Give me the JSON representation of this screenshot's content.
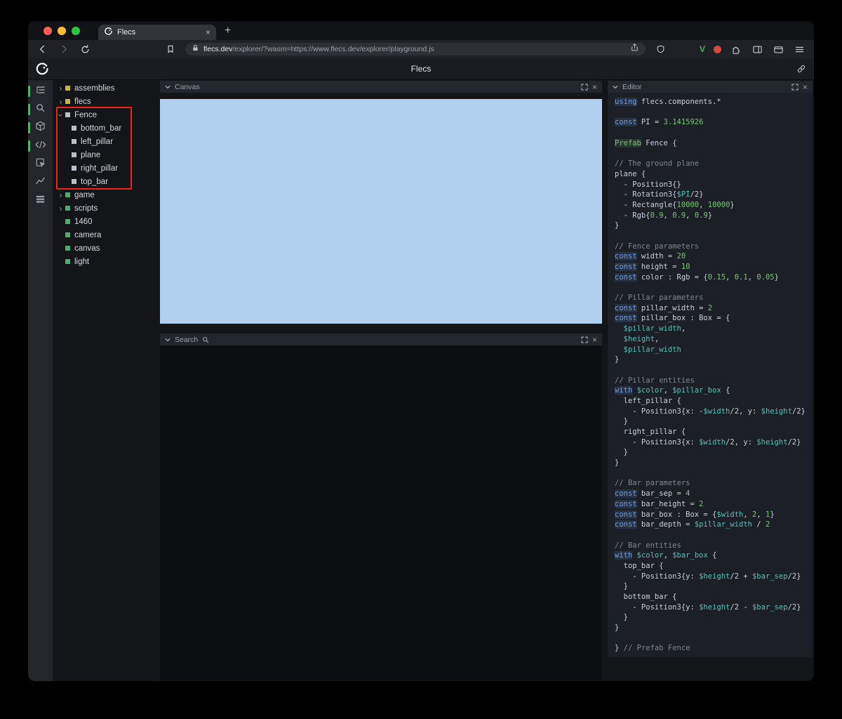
{
  "ui": {
    "close_glyph": "×",
    "plus_glyph": "+",
    "arrow_glyph": "›"
  },
  "browser": {
    "tab_title": "Flecs",
    "url_domain": "flecs.dev",
    "url_path": "/explorer/?wasm=https://www.flecs.dev/explorer/playground.js",
    "v_badge": "V"
  },
  "header": {
    "title": "Flecs"
  },
  "panels": {
    "canvas": {
      "title": "Canvas"
    },
    "search": {
      "title": "Search"
    },
    "editor": {
      "title": "Editor"
    }
  },
  "colors": {
    "accent_green": "#54b06a",
    "annotation_red": "#f0241a",
    "canvas_blue": "#b1d0f0",
    "tree_yellow": "#c9b34a",
    "tree_gray": "#b9bfc8",
    "tree_green": "#4fae6d",
    "traffic_red": "#ff5f57",
    "traffic_yellow": "#febc2e",
    "traffic_green": "#28c840"
  },
  "icons": [
    "flecs-logo-icon",
    "back-icon",
    "forward-icon",
    "reload-icon",
    "bookmark-icon",
    "lock-icon",
    "share-icon",
    "shield-icon",
    "v-extension-icon",
    "record-icon",
    "puzzle-icon",
    "sidebar-toggle-icon",
    "wallet-icon",
    "menu-icon",
    "link-icon",
    "chevron-down-icon",
    "expand-icon",
    "close-icon",
    "magnifier-icon",
    "outliner-icon",
    "search-icon",
    "cube-icon",
    "code-icon",
    "inspect-icon",
    "chart-icon",
    "stats-icon"
  ],
  "tree": {
    "items": [
      {
        "label": "assemblies",
        "square": "yellow",
        "state": "closed",
        "depth": 0
      },
      {
        "label": "flecs",
        "square": "yellow",
        "state": "closed",
        "depth": 0
      },
      {
        "label": "Fence",
        "square": "gray",
        "state": "open",
        "depth": 0
      },
      {
        "label": "bottom_bar",
        "square": "gray",
        "state": "leaf",
        "depth": 1
      },
      {
        "label": "left_pillar",
        "square": "gray",
        "state": "leaf",
        "depth": 1
      },
      {
        "label": "plane",
        "square": "gray",
        "state": "leaf",
        "depth": 1
      },
      {
        "label": "right_pillar",
        "square": "gray",
        "state": "leaf",
        "depth": 1
      },
      {
        "label": "top_bar",
        "square": "gray",
        "state": "leaf",
        "depth": 1
      },
      {
        "label": "game",
        "square": "green",
        "state": "closed",
        "depth": 0
      },
      {
        "label": "scripts",
        "square": "green",
        "state": "closed",
        "depth": 0
      },
      {
        "label": "1460",
        "square": "green",
        "state": "leaf",
        "depth": 0
      },
      {
        "label": "camera",
        "square": "green",
        "state": "leaf",
        "depth": 0
      },
      {
        "label": "canvas",
        "square": "green",
        "state": "leaf",
        "depth": 0
      },
      {
        "label": "light",
        "square": "green",
        "state": "leaf",
        "depth": 0
      }
    ]
  },
  "code": {
    "lines": [
      [
        [
          "kw",
          "using"
        ],
        [
          "pl",
          " flecs.components.*"
        ]
      ],
      [],
      [
        [
          "kw",
          "const"
        ],
        [
          "pl",
          " PI = "
        ],
        [
          "num",
          "3.1415926"
        ]
      ],
      [],
      [
        [
          "pf",
          "Prefab"
        ],
        [
          "pl",
          " Fence {"
        ]
      ],
      [],
      [
        [
          "cm",
          "// The ground plane"
        ]
      ],
      [
        [
          "pl",
          "plane {"
        ]
      ],
      [
        [
          "pl",
          "  - Position3{}"
        ]
      ],
      [
        [
          "pl",
          "  - Rotation3{"
        ],
        [
          "var",
          "$PI"
        ],
        [
          "pl",
          "/2}"
        ]
      ],
      [
        [
          "pl",
          "  - Rectangle{"
        ],
        [
          "num",
          "10000"
        ],
        [
          "pl",
          ", "
        ],
        [
          "num",
          "10000"
        ],
        [
          "pl",
          "}"
        ]
      ],
      [
        [
          "pl",
          "  - Rgb{"
        ],
        [
          "num",
          "0.9"
        ],
        [
          "pl",
          ", "
        ],
        [
          "num",
          "0.9"
        ],
        [
          "pl",
          ", "
        ],
        [
          "num",
          "0.9"
        ],
        [
          "pl",
          "}"
        ]
      ],
      [
        [
          "pl",
          "}"
        ]
      ],
      [],
      [
        [
          "cm",
          "// Fence parameters"
        ]
      ],
      [
        [
          "kw",
          "const"
        ],
        [
          "pl",
          " width = "
        ],
        [
          "num",
          "20"
        ]
      ],
      [
        [
          "kw",
          "const"
        ],
        [
          "pl",
          " height = "
        ],
        [
          "num",
          "10"
        ]
      ],
      [
        [
          "kw",
          "const"
        ],
        [
          "pl",
          " color : Rgb = {"
        ],
        [
          "num",
          "0.15"
        ],
        [
          "pl",
          ", "
        ],
        [
          "num",
          "0.1"
        ],
        [
          "pl",
          ", "
        ],
        [
          "num",
          "0.05"
        ],
        [
          "pl",
          "}"
        ]
      ],
      [],
      [
        [
          "cm",
          "// Pillar parameters"
        ]
      ],
      [
        [
          "kw",
          "const"
        ],
        [
          "pl",
          " pillar_width = "
        ],
        [
          "num",
          "2"
        ]
      ],
      [
        [
          "kw",
          "const"
        ],
        [
          "pl",
          " pillar_box : Box = {"
        ]
      ],
      [
        [
          "pl",
          "  "
        ],
        [
          "var",
          "$pillar_width"
        ],
        [
          "pl",
          ","
        ]
      ],
      [
        [
          "pl",
          "  "
        ],
        [
          "var",
          "$height"
        ],
        [
          "pl",
          ","
        ]
      ],
      [
        [
          "pl",
          "  "
        ],
        [
          "var",
          "$pillar_width"
        ]
      ],
      [
        [
          "pl",
          "}"
        ]
      ],
      [],
      [
        [
          "cm",
          "// Pillar entities"
        ]
      ],
      [
        [
          "kw",
          "with"
        ],
        [
          "pl",
          " "
        ],
        [
          "var",
          "$color"
        ],
        [
          "pl",
          ", "
        ],
        [
          "var",
          "$pillar_box"
        ],
        [
          "pl",
          " {"
        ]
      ],
      [
        [
          "pl",
          "  left_pillar {"
        ]
      ],
      [
        [
          "pl",
          "    - Position3{x: -"
        ],
        [
          "var",
          "$width"
        ],
        [
          "pl",
          "/2, y: "
        ],
        [
          "var",
          "$height"
        ],
        [
          "pl",
          "/2}"
        ]
      ],
      [
        [
          "pl",
          "  }"
        ]
      ],
      [
        [
          "pl",
          "  right_pillar {"
        ]
      ],
      [
        [
          "pl",
          "    - Position3{x: "
        ],
        [
          "var",
          "$width"
        ],
        [
          "pl",
          "/2, y: "
        ],
        [
          "var",
          "$height"
        ],
        [
          "pl",
          "/2}"
        ]
      ],
      [
        [
          "pl",
          "  }"
        ]
      ],
      [
        [
          "pl",
          "}"
        ]
      ],
      [],
      [
        [
          "cm",
          "// Bar parameters"
        ]
      ],
      [
        [
          "kw",
          "const"
        ],
        [
          "pl",
          " bar_sep = "
        ],
        [
          "num",
          "4"
        ]
      ],
      [
        [
          "kw",
          "const"
        ],
        [
          "pl",
          " bar_height = "
        ],
        [
          "num",
          "2"
        ]
      ],
      [
        [
          "kw",
          "const"
        ],
        [
          "pl",
          " bar_box : Box = {"
        ],
        [
          "var",
          "$width"
        ],
        [
          "pl",
          ", "
        ],
        [
          "num",
          "2"
        ],
        [
          "pl",
          ", "
        ],
        [
          "num",
          "1"
        ],
        [
          "pl",
          "}"
        ]
      ],
      [
        [
          "kw",
          "const"
        ],
        [
          "pl",
          " bar_depth = "
        ],
        [
          "var",
          "$pillar_width"
        ],
        [
          "pl",
          " / "
        ],
        [
          "num",
          "2"
        ]
      ],
      [],
      [
        [
          "cm",
          "// Bar entities"
        ]
      ],
      [
        [
          "kw",
          "with"
        ],
        [
          "pl",
          " "
        ],
        [
          "var",
          "$color"
        ],
        [
          "pl",
          ", "
        ],
        [
          "var",
          "$bar_box"
        ],
        [
          "pl",
          " {"
        ]
      ],
      [
        [
          "pl",
          "  top_bar {"
        ]
      ],
      [
        [
          "pl",
          "    - Position3{y: "
        ],
        [
          "var",
          "$height"
        ],
        [
          "pl",
          "/2 + "
        ],
        [
          "var",
          "$bar_sep"
        ],
        [
          "pl",
          "/2}"
        ]
      ],
      [
        [
          "pl",
          "  }"
        ]
      ],
      [
        [
          "pl",
          "  bottom_bar {"
        ]
      ],
      [
        [
          "pl",
          "    - Position3{y: "
        ],
        [
          "var",
          "$height"
        ],
        [
          "pl",
          "/2 - "
        ],
        [
          "var",
          "$bar_sep"
        ],
        [
          "pl",
          "/2}"
        ]
      ],
      [
        [
          "pl",
          "  }"
        ]
      ],
      [
        [
          "pl",
          "}"
        ]
      ],
      [],
      [
        [
          "pl",
          "} "
        ],
        [
          "cm",
          "// Prefab Fence"
        ]
      ]
    ]
  }
}
